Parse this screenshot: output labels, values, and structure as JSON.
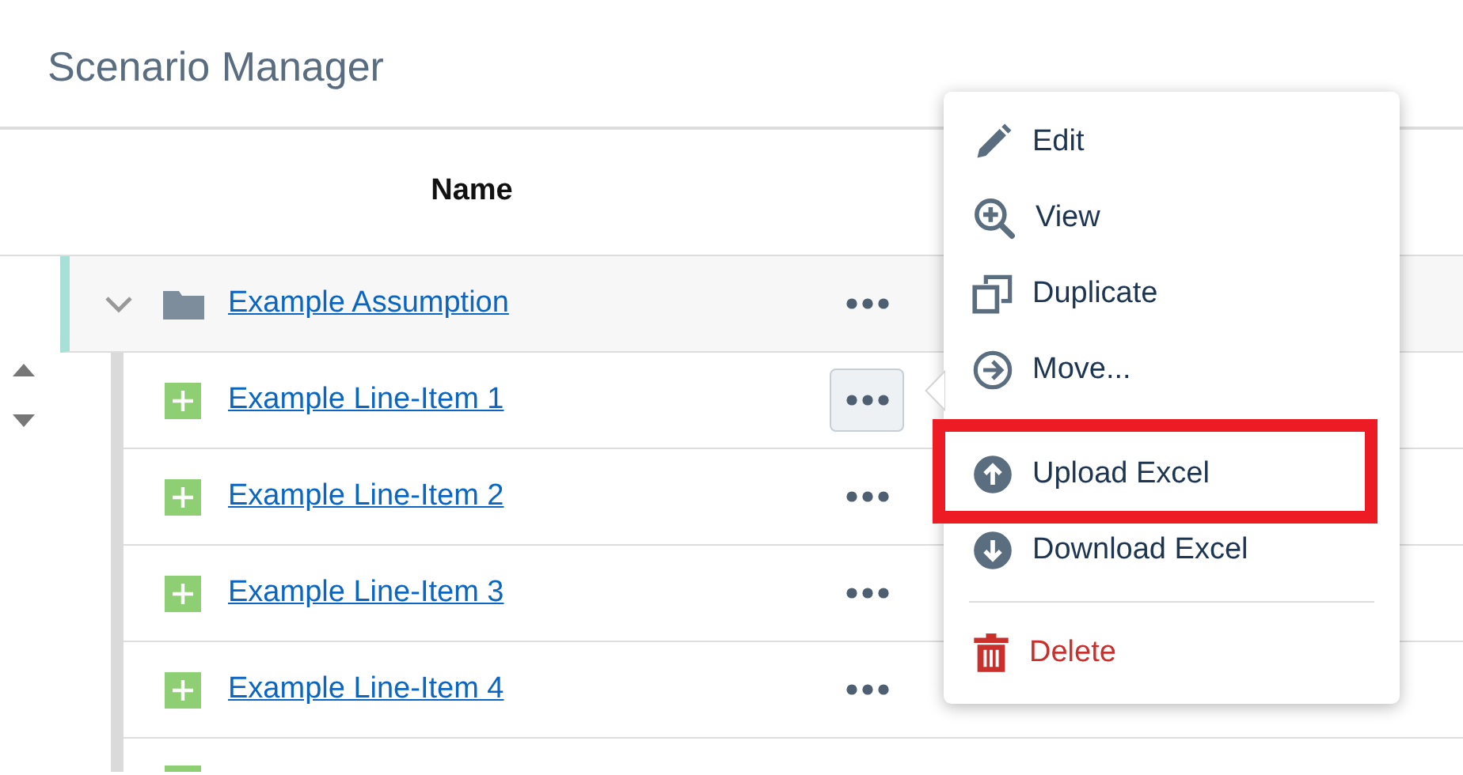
{
  "header": {
    "title": "Scenario Manager"
  },
  "table": {
    "columns": [
      {
        "label": "Name"
      }
    ],
    "rows": [
      {
        "kind": "group",
        "name": "Example Assumption",
        "expanded": true,
        "children": [
          {
            "kind": "item",
            "name": "Example Line-Item 1",
            "menu_open": true
          },
          {
            "kind": "item",
            "name": "Example Line-Item 2"
          },
          {
            "kind": "item",
            "name": "Example Line-Item 3"
          },
          {
            "kind": "item",
            "name": "Example Line-Item 4"
          },
          {
            "kind": "item"
          }
        ]
      }
    ]
  },
  "context_menu": {
    "items": [
      {
        "kind": "action",
        "label": "Edit",
        "highlighted": false
      },
      {
        "kind": "action",
        "label": "View",
        "highlighted": false
      },
      {
        "kind": "action",
        "label": "Duplicate",
        "highlighted": false
      },
      {
        "kind": "action",
        "label": "Move...",
        "highlighted": false
      },
      {
        "kind": "action",
        "label": "Upload Excel",
        "highlighted": true
      },
      {
        "kind": "action",
        "label": "Download Excel",
        "highlighted": false
      },
      {
        "kind": "divider"
      },
      {
        "kind": "danger",
        "label": "Delete",
        "highlighted": false
      }
    ]
  }
}
